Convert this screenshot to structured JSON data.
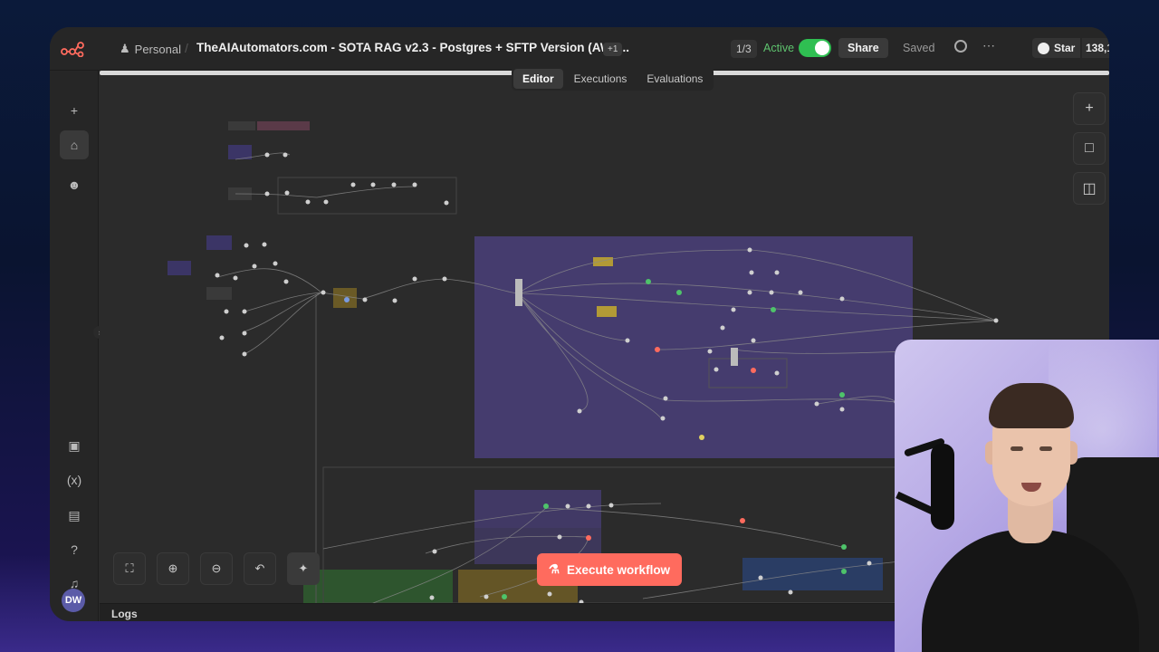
{
  "header": {
    "project": "Personal",
    "workflow_title": "TheAIAutomators.com - SOTA RAG v2.3 - Postgres + SFTP Version (AW) ...",
    "tag_more": "+1",
    "version_count": "1/3",
    "status": "Active",
    "share_label": "Share",
    "saved_label": "Saved",
    "star_label": "Star",
    "star_count": "138,1"
  },
  "tabs": [
    {
      "label": "Editor",
      "active": true
    },
    {
      "label": "Executions",
      "active": false
    },
    {
      "label": "Evaluations",
      "active": false
    }
  ],
  "sidebar": {
    "items": [
      {
        "icon": "plus-icon"
      },
      {
        "icon": "home-icon",
        "active": true
      },
      {
        "icon": "user-icon"
      },
      {
        "icon": "package-icon"
      },
      {
        "icon": "variables-icon"
      },
      {
        "icon": "chart-icon"
      },
      {
        "icon": "help-icon"
      },
      {
        "icon": "bell-icon"
      }
    ],
    "avatar_initials": "DW"
  },
  "canvas": {
    "execute_label": "Execute workflow",
    "right_tools": [
      "plus-icon",
      "sticky-note-icon",
      "panel-icon"
    ],
    "bottom_tools": [
      "fit-view-icon",
      "zoom-in-icon",
      "zoom-out-icon",
      "undo-icon",
      "tidy-up-icon"
    ]
  },
  "logs_label": "Logs",
  "colors": {
    "accent": "#ff6b5e",
    "active": "#2fbf52",
    "group_purple": "#4a3f7a",
    "group_green": "#2f5a2f",
    "group_olive": "#6a5a26",
    "group_blue": "#2a3f6a"
  }
}
